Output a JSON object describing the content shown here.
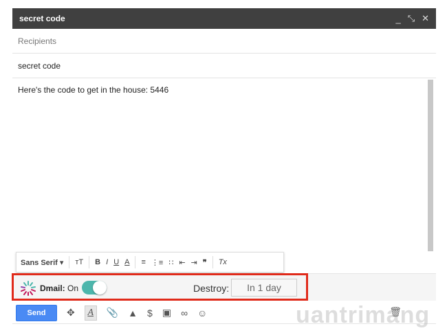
{
  "window": {
    "title": "secret code",
    "minimize": "_",
    "popout": "⤡",
    "close": "✕"
  },
  "recipients_placeholder": "Recipients",
  "subject": "secret code",
  "body": "Here's the code to get in the house: 5446",
  "format_toolbar": {
    "font": "Sans Serif",
    "size": "тT",
    "bold": "B",
    "italic": "I",
    "underline": "U",
    "color": "A",
    "align": "≡",
    "numbered": "⋮≡",
    "bulleted": "∷",
    "indent_less": "⇤",
    "indent_more": "⇥",
    "quote": "❞",
    "clear": "Tx",
    "dropdown": "▾"
  },
  "dmail": {
    "label": "Dmail:",
    "state": "On",
    "enabled": true,
    "destroy_label": "Destroy:",
    "destroy_value": "In 1 day",
    "accent": "#4db6ac",
    "highlight": "#e02a1a"
  },
  "bottom_toolbar": {
    "send": "Send",
    "dropbox": "✥",
    "format": "A",
    "attach": "📎",
    "drive": "▲",
    "money": "$",
    "photo": "▣",
    "link": "∞",
    "emoji": "☺",
    "trash": "🗑"
  },
  "watermark": "uantrimang"
}
